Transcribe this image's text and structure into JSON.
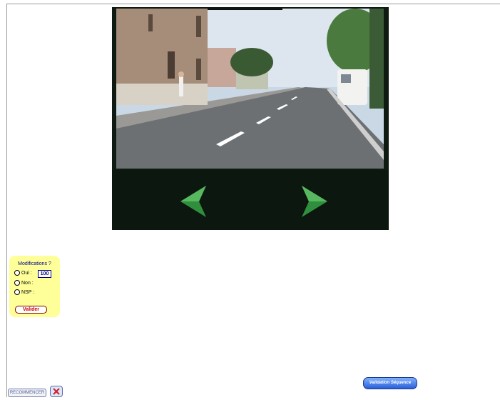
{
  "quiz": {
    "title": "Modifications ?",
    "options": [
      {
        "label": "Oui :"
      },
      {
        "label": "Non :"
      },
      {
        "label": "NSP :"
      }
    ],
    "score_value": "100",
    "validate_label": "Valider"
  },
  "controls": {
    "restart_label": "RECOMMENCER",
    "close_icon": "close-x-icon",
    "validation_sequence_label": "Validation Séquence"
  },
  "video": {
    "prev_icon": "arrow-left-icon",
    "next_icon": "arrow-right-icon"
  },
  "colors": {
    "quiz_bg": "#ffff99",
    "arrow_green": "#2e8b3a",
    "validate_text": "#cc0000",
    "validation_button": "#2a5fd8"
  }
}
